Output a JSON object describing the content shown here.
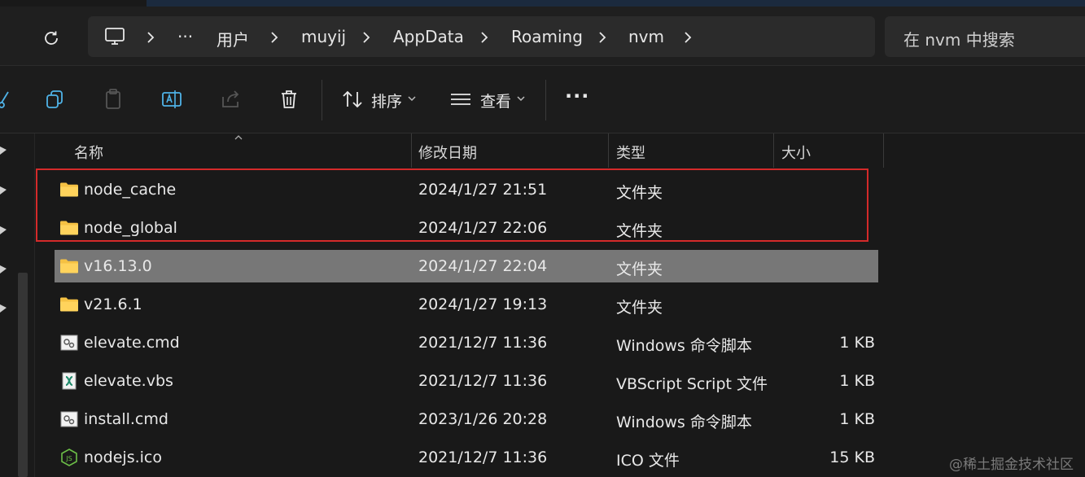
{
  "breadcrumb": {
    "more": "···",
    "items": [
      "用户",
      "muyij",
      "AppData",
      "Roaming",
      "nvm"
    ]
  },
  "search": {
    "placeholder": "在 nvm 中搜索"
  },
  "toolbar": {
    "sort_label": "排序",
    "view_label": "查看",
    "more_label": "···"
  },
  "columns": {
    "name": "名称",
    "modified": "修改日期",
    "type": "类型",
    "size": "大小"
  },
  "files": [
    {
      "name": "node_cache",
      "modified": "2024/1/27 21:51",
      "type": "文件夹",
      "size": "",
      "icon": "folder-icon"
    },
    {
      "name": "node_global",
      "modified": "2024/1/27 22:06",
      "type": "文件夹",
      "size": "",
      "icon": "folder-icon"
    },
    {
      "name": "v16.13.0",
      "modified": "2024/1/27 22:04",
      "type": "文件夹",
      "size": "",
      "icon": "folder-icon",
      "selected": true
    },
    {
      "name": "v21.6.1",
      "modified": "2024/1/27 19:13",
      "type": "文件夹",
      "size": "",
      "icon": "folder-icon"
    },
    {
      "name": "elevate.cmd",
      "modified": "2021/12/7 11:36",
      "type": "Windows 命令脚本",
      "size": "1 KB",
      "icon": "cmd-file-icon"
    },
    {
      "name": "elevate.vbs",
      "modified": "2021/12/7 11:36",
      "type": "VBScript Script 文件",
      "size": "1 KB",
      "icon": "vbs-file-icon"
    },
    {
      "name": "install.cmd",
      "modified": "2023/1/26 20:28",
      "type": "Windows 命令脚本",
      "size": "1 KB",
      "icon": "cmd-file-icon"
    },
    {
      "name": "nodejs.ico",
      "modified": "2021/12/7 11:36",
      "type": "ICO 文件",
      "size": "15 KB",
      "icon": "nodejs-icon"
    }
  ],
  "colors": {
    "highlight": "#d42a2a",
    "folder": "#f5c143",
    "selected_row": "#777777"
  },
  "watermark": "@稀土掘金技术社区"
}
